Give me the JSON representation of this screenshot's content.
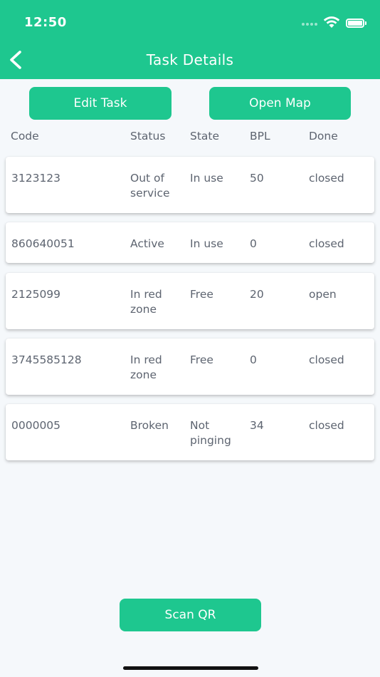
{
  "status_bar": {
    "time": "12:50"
  },
  "header": {
    "title": "Task Details"
  },
  "actions": {
    "edit_label": "Edit Task",
    "map_label": "Open Map",
    "scan_label": "Scan QR"
  },
  "columns": [
    "Code",
    "Status",
    "State",
    "BPL",
    "Done"
  ],
  "rows": [
    {
      "code": "3123123",
      "status": "Out of service",
      "state": "In use",
      "bpl": "50",
      "done": "closed"
    },
    {
      "code": "860640051",
      "status": "Active",
      "state": "In use",
      "bpl": "0",
      "done": "closed"
    },
    {
      "code": "2125099",
      "status": "In red zone",
      "state": "Free",
      "bpl": "20",
      "done": "open"
    },
    {
      "code": "3745585128",
      "status": "In red zone",
      "state": "Free",
      "bpl": "0",
      "done": "closed"
    },
    {
      "code": "0000005",
      "status": "Broken",
      "state": "Not pinging",
      "bpl": "34",
      "done": "closed"
    }
  ],
  "colors": {
    "accent": "#1ec78f",
    "text": "#5d6470",
    "background": "#f5f8fb"
  },
  "icons": {
    "back": "chevron-left-icon",
    "wifi": "wifi-icon",
    "battery": "battery-icon"
  }
}
